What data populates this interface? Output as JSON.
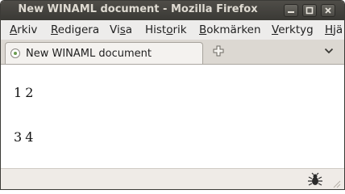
{
  "window": {
    "title": "New WINAML document - Mozilla Firefox"
  },
  "menubar": {
    "items": [
      {
        "underline": "A",
        "rest": "rkiv"
      },
      {
        "underline": "R",
        "rest": "edigera"
      },
      {
        "pre": "Vi",
        "underline": "s",
        "rest": "a"
      },
      {
        "pre": "Hist",
        "underline": "o",
        "rest": "rik"
      },
      {
        "underline": "B",
        "rest": "okmärken"
      },
      {
        "underline": "V",
        "rest": "erktyg"
      },
      {
        "pre": "",
        "underline": "H",
        "rest": "jä"
      }
    ]
  },
  "tabs": {
    "active_label": "New WINAML document"
  },
  "content": {
    "rows": [
      [
        "1",
        "2"
      ],
      [
        "3",
        "4"
      ]
    ]
  },
  "icons": {
    "minimize": "minimize-icon",
    "maximize": "maximize-icon",
    "close": "close-icon",
    "new_tab": "plus-icon",
    "tab_list": "chevron-down-icon",
    "status": "bug-icon"
  }
}
